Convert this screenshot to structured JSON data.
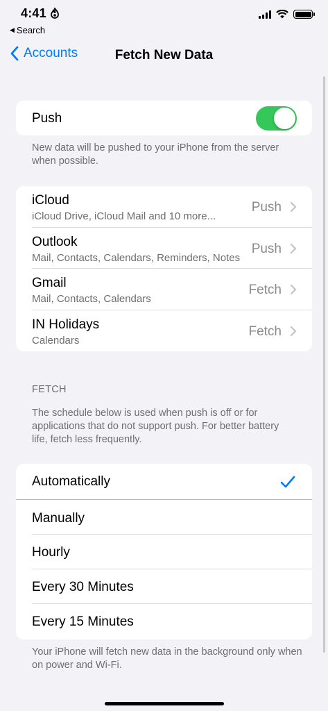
{
  "status_bar": {
    "time": "4:41",
    "back_app": "Search"
  },
  "nav": {
    "back_label": "Accounts",
    "title": "Fetch New Data"
  },
  "push": {
    "label": "Push",
    "enabled": true,
    "footer": "New data will be pushed to your iPhone from the server when possible."
  },
  "accounts": [
    {
      "name": "iCloud",
      "detail": "iCloud Drive, iCloud Mail and 10 more...",
      "value": "Push"
    },
    {
      "name": "Outlook",
      "detail": "Mail, Contacts, Calendars, Reminders, Notes",
      "value": "Push"
    },
    {
      "name": "Gmail",
      "detail": "Mail, Contacts, Calendars",
      "value": "Fetch"
    },
    {
      "name": "IN Holidays",
      "detail": "Calendars",
      "value": "Fetch"
    }
  ],
  "fetch": {
    "header": "FETCH",
    "description": "The schedule below is used when push is off or for applications that do not support push. For better battery life, fetch less frequently.",
    "options": [
      {
        "label": "Automatically",
        "selected": true
      },
      {
        "label": "Manually",
        "selected": false
      },
      {
        "label": "Hourly",
        "selected": false
      },
      {
        "label": "Every 30 Minutes",
        "selected": false
      },
      {
        "label": "Every 15 Minutes",
        "selected": false
      }
    ],
    "footer": "Your iPhone will fetch new data in the background only when on power and Wi-Fi."
  },
  "colors": {
    "accent": "#007aff",
    "toggle_on": "#34c759",
    "background": "#f2f2f7"
  }
}
